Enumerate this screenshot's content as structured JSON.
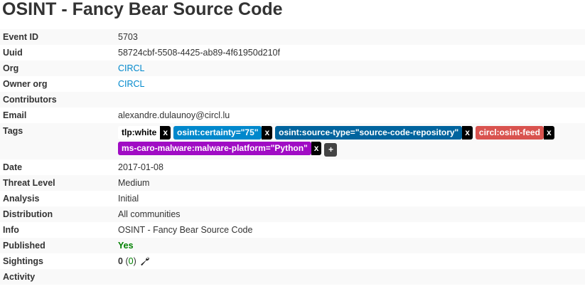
{
  "title": "OSINT - Fancy Bear Source Code",
  "fields": {
    "event_id": {
      "label": "Event ID",
      "value": "5703"
    },
    "uuid": {
      "label": "Uuid",
      "value": "58724cbf-5508-4425-ab89-4f61950d210f"
    },
    "org": {
      "label": "Org",
      "value": "CIRCL"
    },
    "owner_org": {
      "label": "Owner org",
      "value": "CIRCL"
    },
    "contributors": {
      "label": "Contributors",
      "value": ""
    },
    "email": {
      "label": "Email",
      "value": "alexandre.dulaunoy@circl.lu"
    },
    "tags_label": "Tags",
    "date": {
      "label": "Date",
      "value": "2017-01-08"
    },
    "threat_level": {
      "label": "Threat Level",
      "value": "Medium"
    },
    "analysis": {
      "label": "Analysis",
      "value": "Initial"
    },
    "distribution": {
      "label": "Distribution",
      "value": "All communities"
    },
    "info": {
      "label": "Info",
      "value": "OSINT - Fancy Bear Source Code"
    },
    "published": {
      "label": "Published",
      "value": "Yes"
    },
    "sightings": {
      "label": "Sightings",
      "count": "0",
      "open": "(",
      "inner": "0",
      "close": ")"
    },
    "activity": {
      "label": "Activity"
    }
  },
  "tags": [
    {
      "label": "tlp:white",
      "bg": "#ffffff",
      "fg": "#000000"
    },
    {
      "label": "osint:certainty=\"75\"",
      "bg": "#0088cc",
      "fg": "#ffffff"
    },
    {
      "label": "osint:source-type=\"source-code-repository\"",
      "bg": "#00649e",
      "fg": "#ffffff"
    },
    {
      "label": "circl:osint-feed",
      "bg": "#d9534f",
      "fg": "#ffffff"
    },
    {
      "label": "ms-caro-malware:malware-platform=\"Python\"",
      "bg": "#a00cc4",
      "fg": "#ffffff"
    }
  ],
  "tag_remove_label": "x",
  "tag_add_label": "+",
  "icons": {
    "sightings_action": "wrench-icon"
  },
  "colors": {
    "link": "#0088cc",
    "published": "#008000",
    "row_stripe": "#f9f9f9"
  }
}
